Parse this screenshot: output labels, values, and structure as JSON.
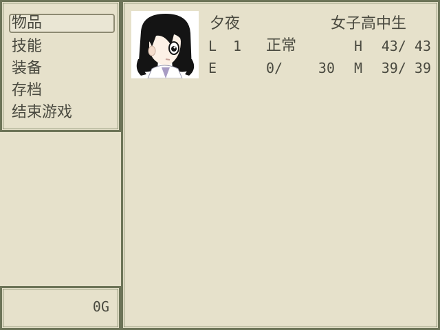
{
  "menu": {
    "items": [
      {
        "label": "物品",
        "selected": true
      },
      {
        "label": "技能",
        "selected": false
      },
      {
        "label": "装备",
        "selected": false
      },
      {
        "label": "存档",
        "selected": false
      },
      {
        "label": "结束游戏",
        "selected": false
      }
    ]
  },
  "gold": {
    "text": "0G"
  },
  "actor": {
    "name": "夕夜",
    "class": "女子高中生",
    "level_label": "L",
    "level": "1",
    "state": "正常",
    "hp_label": "H",
    "hp": "43/ 43",
    "exp_label": "E",
    "exp_current": "0/",
    "exp_next": "30",
    "mp_label": "M",
    "mp": "39/ 39"
  },
  "colors": {
    "window_bg": "#e6e1cb",
    "window_border": "#6d7458",
    "text": "#4a4a40"
  }
}
